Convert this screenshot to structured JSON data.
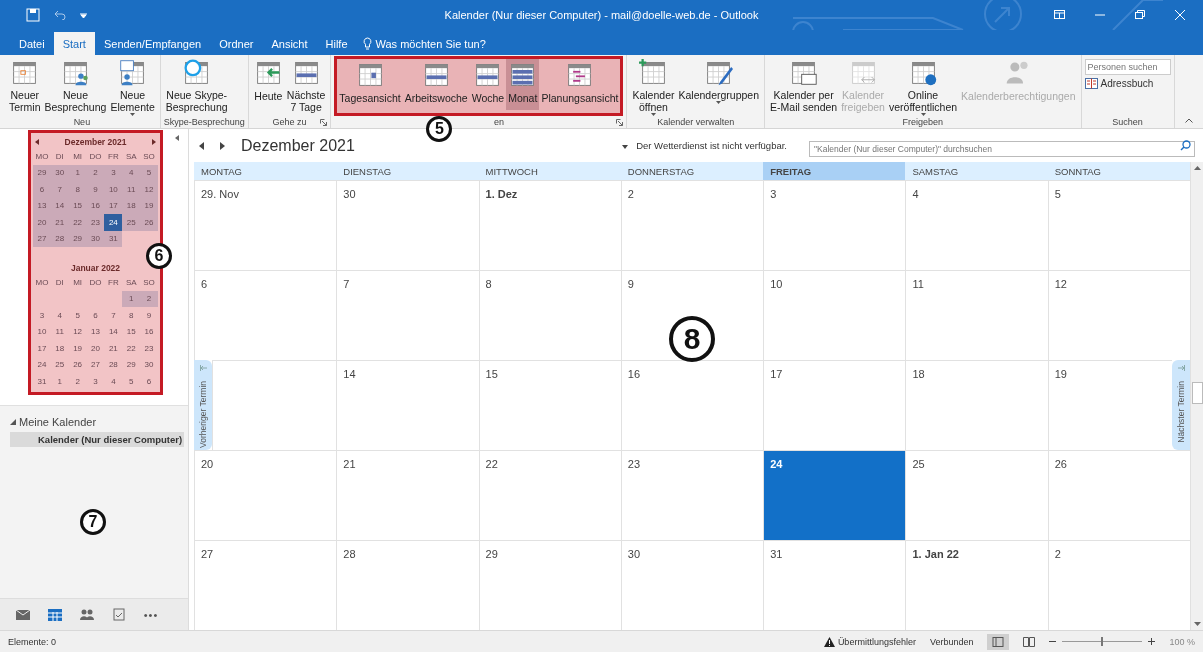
{
  "window": {
    "title": "Kalender (Nur dieser Computer) - mail@doelle-web.de  -  Outlook"
  },
  "ribbon_tabs": [
    {
      "label": "Datei",
      "selected": false
    },
    {
      "label": "Start",
      "selected": true
    },
    {
      "label": "Senden/Empfangen",
      "selected": false
    },
    {
      "label": "Ordner",
      "selected": false
    },
    {
      "label": "Ansicht",
      "selected": false
    },
    {
      "label": "Hilfe",
      "selected": false
    }
  ],
  "tell_me": "Was möchten Sie tun?",
  "ribbon_groups": [
    {
      "label": "Neu",
      "highlighted": false,
      "launcher": false,
      "buttons": [
        {
          "label": "Neuer\nTermin",
          "disabled": false,
          "selected": false,
          "dropdown": false
        },
        {
          "label": "Neue\nBesprechung",
          "disabled": false,
          "selected": false,
          "dropdown": false
        },
        {
          "label": "Neue\nElemente",
          "disabled": false,
          "selected": false,
          "dropdown": true
        }
      ]
    },
    {
      "label": "Skype-Besprechung",
      "highlighted": false,
      "launcher": false,
      "buttons": [
        {
          "label": "Neue Skype-\nBesprechung",
          "disabled": false,
          "selected": false,
          "dropdown": false
        }
      ]
    },
    {
      "label": "Gehe zu",
      "highlighted": false,
      "launcher": true,
      "buttons": [
        {
          "label": "Heute",
          "disabled": false,
          "selected": false,
          "dropdown": false
        },
        {
          "label": "Nächste\n7 Tage",
          "disabled": false,
          "selected": false,
          "dropdown": false
        }
      ]
    },
    {
      "label": "en",
      "highlighted": true,
      "callout": "5",
      "launcher": true,
      "buttons": [
        {
          "label": "Tagesansicht",
          "disabled": false,
          "selected": false,
          "dropdown": false
        },
        {
          "label": "Arbeitswoche",
          "disabled": false,
          "selected": false,
          "dropdown": false
        },
        {
          "label": "Woche",
          "disabled": false,
          "selected": false,
          "dropdown": false
        },
        {
          "label": "Monat",
          "disabled": false,
          "selected": true,
          "dropdown": false
        },
        {
          "label": "Planungsansicht",
          "disabled": false,
          "selected": false,
          "dropdown": false
        }
      ]
    },
    {
      "label": "Kalender verwalten",
      "highlighted": false,
      "launcher": false,
      "buttons": [
        {
          "label": "Kalender\nöffnen",
          "disabled": false,
          "selected": false,
          "dropdown": true
        },
        {
          "label": "Kalendergruppen",
          "disabled": false,
          "selected": false,
          "dropdown": true
        }
      ]
    },
    {
      "label": "Freigeben",
      "highlighted": false,
      "launcher": false,
      "buttons": [
        {
          "label": "Kalender per\nE-Mail senden",
          "disabled": false,
          "selected": false,
          "dropdown": false
        },
        {
          "label": "Kalender\nfreigeben",
          "disabled": true,
          "selected": false,
          "dropdown": false
        },
        {
          "label": "Online\nveröffentlichen",
          "disabled": false,
          "selected": false,
          "dropdown": true
        },
        {
          "label": "Kalenderberechtigungen",
          "disabled": true,
          "selected": false,
          "dropdown": false
        }
      ]
    }
  ],
  "search_group": {
    "label": "Suchen",
    "field": {
      "placeholder": "Personen suchen"
    },
    "address_book": "Adressbuch"
  },
  "mini_calendar": {
    "highlighted": true,
    "callout": "6",
    "months": [
      {
        "title": "Dezember 2021",
        "weekdays": [
          "MO",
          "DI",
          "MI",
          "DO",
          "FR",
          "SA",
          "SO"
        ],
        "weeks": [
          [
            {
              "day": "29",
              "in_range": true,
              "selected": false
            },
            {
              "day": "30",
              "in_range": true,
              "selected": false
            },
            {
              "day": "1",
              "in_range": true,
              "selected": false
            },
            {
              "day": "2",
              "in_range": true,
              "selected": false
            },
            {
              "day": "3",
              "in_range": true,
              "selected": false
            },
            {
              "day": "4",
              "in_range": true,
              "selected": false
            },
            {
              "day": "5",
              "in_range": true,
              "selected": false
            }
          ],
          [
            {
              "day": "6",
              "in_range": true,
              "selected": false
            },
            {
              "day": "7",
              "in_range": true,
              "selected": false
            },
            {
              "day": "8",
              "in_range": true,
              "selected": false
            },
            {
              "day": "9",
              "in_range": true,
              "selected": false
            },
            {
              "day": "10",
              "in_range": true,
              "selected": false
            },
            {
              "day": "11",
              "in_range": true,
              "selected": false
            },
            {
              "day": "12",
              "in_range": true,
              "selected": false
            }
          ],
          [
            {
              "day": "13",
              "in_range": true,
              "selected": false
            },
            {
              "day": "14",
              "in_range": true,
              "selected": false
            },
            {
              "day": "15",
              "in_range": true,
              "selected": false
            },
            {
              "day": "16",
              "in_range": true,
              "selected": false
            },
            {
              "day": "17",
              "in_range": true,
              "selected": false
            },
            {
              "day": "18",
              "in_range": true,
              "selected": false
            },
            {
              "day": "19",
              "in_range": true,
              "selected": false
            }
          ],
          [
            {
              "day": "20",
              "in_range": true,
              "selected": false
            },
            {
              "day": "21",
              "in_range": true,
              "selected": false
            },
            {
              "day": "22",
              "in_range": true,
              "selected": false
            },
            {
              "day": "23",
              "in_range": true,
              "selected": false
            },
            {
              "day": "24",
              "in_range": true,
              "selected": true
            },
            {
              "day": "25",
              "in_range": true,
              "selected": false
            },
            {
              "day": "26",
              "in_range": true,
              "selected": false
            }
          ],
          [
            {
              "day": "27",
              "in_range": true,
              "selected": false
            },
            {
              "day": "28",
              "in_range": true,
              "selected": false
            },
            {
              "day": "29",
              "in_range": true,
              "selected": false
            },
            {
              "day": "30",
              "in_range": true,
              "selected": false
            },
            {
              "day": "31",
              "in_range": true,
              "selected": false
            }
          ]
        ]
      },
      {
        "title": "Januar 2022",
        "weekdays": [
          "MO",
          "DI",
          "MI",
          "DO",
          "FR",
          "SA",
          "SO"
        ],
        "weeks": [
          [
            {
              "day": "1",
              "in_range": true,
              "selected": false
            },
            {
              "day": "2",
              "in_range": true,
              "selected": false
            }
          ],
          [
            {
              "day": "3",
              "in_range": false,
              "selected": false
            },
            {
              "day": "4",
              "in_range": false,
              "selected": false
            },
            {
              "day": "5",
              "in_range": false,
              "selected": false
            },
            {
              "day": "6",
              "in_range": false,
              "selected": false
            },
            {
              "day": "7",
              "in_range": false,
              "selected": false
            },
            {
              "day": "8",
              "in_range": false,
              "selected": false
            },
            {
              "day": "9",
              "in_range": false,
              "selected": false
            }
          ],
          [
            {
              "day": "10",
              "in_range": false,
              "selected": false
            },
            {
              "day": "11",
              "in_range": false,
              "selected": false
            },
            {
              "day": "12",
              "in_range": false,
              "selected": false
            },
            {
              "day": "13",
              "in_range": false,
              "selected": false
            },
            {
              "day": "14",
              "in_range": false,
              "selected": false
            },
            {
              "day": "15",
              "in_range": false,
              "selected": false
            },
            {
              "day": "16",
              "in_range": false,
              "selected": false
            }
          ],
          [
            {
              "day": "17",
              "in_range": false,
              "selected": false
            },
            {
              "day": "18",
              "in_range": false,
              "selected": false
            },
            {
              "day": "19",
              "in_range": false,
              "selected": false
            },
            {
              "day": "20",
              "in_range": false,
              "selected": false
            },
            {
              "day": "21",
              "in_range": false,
              "selected": false
            },
            {
              "day": "22",
              "in_range": false,
              "selected": false
            },
            {
              "day": "23",
              "in_range": false,
              "selected": false
            }
          ],
          [
            {
              "day": "24",
              "in_range": false,
              "selected": false
            },
            {
              "day": "25",
              "in_range": false,
              "selected": false
            },
            {
              "day": "26",
              "in_range": false,
              "selected": false
            },
            {
              "day": "27",
              "in_range": false,
              "selected": false
            },
            {
              "day": "28",
              "in_range": false,
              "selected": false
            },
            {
              "day": "29",
              "in_range": false,
              "selected": false
            },
            {
              "day": "30",
              "in_range": false,
              "selected": false
            }
          ],
          [
            {
              "day": "31",
              "in_range": false,
              "selected": false
            },
            {
              "day": "1",
              "in_range": false,
              "selected": false
            },
            {
              "day": "2",
              "in_range": false,
              "selected": false
            },
            {
              "day": "3",
              "in_range": false,
              "selected": false
            },
            {
              "day": "4",
              "in_range": false,
              "selected": false
            },
            {
              "day": "5",
              "in_range": false,
              "selected": false
            },
            {
              "day": "6",
              "in_range": false,
              "selected": false
            }
          ]
        ]
      }
    ]
  },
  "folders": {
    "header": "Meine Kalender",
    "expanded": true,
    "callout": "7",
    "items": [
      {
        "label": "Kalender (Nur dieser Computer)",
        "selected": true
      }
    ]
  },
  "nav_bar": [
    {
      "selected": false
    },
    {
      "selected": true
    },
    {
      "selected": false
    },
    {
      "selected": false
    },
    {
      "text": "•••",
      "selected": false
    }
  ],
  "calendar": {
    "title": "Dezember 2021",
    "weather": "Der Wetterdienst ist nicht verfügbar.",
    "search": {
      "placeholder": "\"Kalender (Nur dieser Computer)\" durchsuchen"
    },
    "prev_tab": "Vorheriger Termin",
    "next_tab": "Nächster Termin",
    "callout": "8",
    "days": [
      {
        "label": "MONTAG",
        "selected": false
      },
      {
        "label": "DIENSTAG",
        "selected": false
      },
      {
        "label": "MITTWOCH",
        "selected": false
      },
      {
        "label": "DONNERSTAG",
        "selected": false
      },
      {
        "label": "FREITAG",
        "selected": true
      },
      {
        "label": "SAMSTAG",
        "selected": false
      },
      {
        "label": "SONNTAG",
        "selected": false
      }
    ],
    "weeks": [
      [
        {
          "label": "29. Nov",
          "bold": false,
          "selected": false
        },
        {
          "label": "30",
          "bold": false,
          "selected": false
        },
        {
          "label": "1. Dez",
          "bold": true,
          "selected": false
        },
        {
          "label": "2",
          "bold": false,
          "selected": false
        },
        {
          "label": "3",
          "bold": false,
          "selected": false
        },
        {
          "label": "4",
          "bold": false,
          "selected": false
        },
        {
          "label": "5",
          "bold": false,
          "selected": false
        }
      ],
      [
        {
          "label": "6",
          "bold": false,
          "selected": false
        },
        {
          "label": "7",
          "bold": false,
          "selected": false
        },
        {
          "label": "8",
          "bold": false,
          "selected": false
        },
        {
          "label": "9",
          "bold": false,
          "selected": false
        },
        {
          "label": "10",
          "bold": false,
          "selected": false
        },
        {
          "label": "11",
          "bold": false,
          "selected": false
        },
        {
          "label": "12",
          "bold": false,
          "selected": false
        }
      ],
      [
        {
          "selected": false
        },
        {
          "label": "14",
          "bold": false,
          "selected": false
        },
        {
          "label": "15",
          "bold": false,
          "selected": false
        },
        {
          "label": "16",
          "bold": false,
          "selected": false
        },
        {
          "label": "17",
          "bold": false,
          "selected": false
        },
        {
          "label": "18",
          "bold": false,
          "selected": false
        },
        {
          "label": "19",
          "bold": false,
          "selected": false
        }
      ],
      [
        {
          "label": "20",
          "bold": false,
          "selected": false
        },
        {
          "label": "21",
          "bold": false,
          "selected": false
        },
        {
          "label": "22",
          "bold": false,
          "selected": false
        },
        {
          "label": "23",
          "bold": false,
          "selected": false
        },
        {
          "label": "24",
          "bold": true,
          "selected": true
        },
        {
          "label": "25",
          "bold": false,
          "selected": false
        },
        {
          "label": "26",
          "bold": false,
          "selected": false
        }
      ],
      [
        {
          "label": "27",
          "bold": false,
          "selected": false
        },
        {
          "label": "28",
          "bold": false,
          "selected": false
        },
        {
          "label": "29",
          "bold": false,
          "selected": false
        },
        {
          "label": "30",
          "bold": false,
          "selected": false
        },
        {
          "label": "31",
          "bold": false,
          "selected": false
        },
        {
          "label": "1. Jan 22",
          "bold": true,
          "selected": false
        },
        {
          "label": "2",
          "bold": false,
          "selected": false
        }
      ]
    ]
  },
  "status_bar": {
    "items": "Elemente: 0",
    "error": "Übermittlungsfehler",
    "connection": "Verbunden",
    "zoom": {
      "level": 0.5,
      "reading": "100 %"
    }
  }
}
